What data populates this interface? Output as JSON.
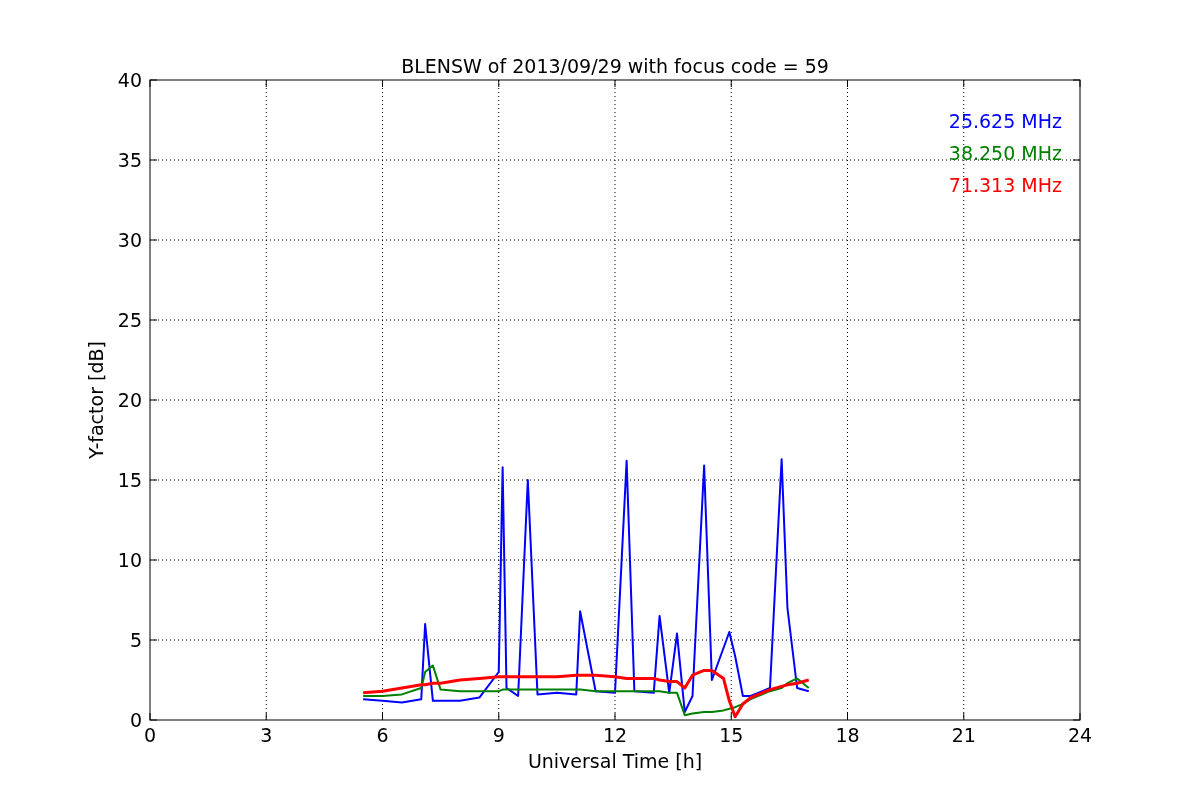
{
  "chart_data": {
    "type": "line",
    "title": "BLENSW of 2013/09/29 with focus code = 59",
    "xlabel": "Universal Time [h]",
    "ylabel": "Y-factor [dB]",
    "x": [
      5.5,
      6,
      6.5,
      7,
      7.1,
      7.3,
      7.5,
      8,
      8.5,
      9,
      9.1,
      9.2,
      9.5,
      9.75,
      10,
      10.5,
      11,
      11.1,
      11.5,
      12,
      12.3,
      12.5,
      13,
      13.15,
      13.4,
      13.6,
      13.8,
      14,
      14.3,
      14.5,
      14.8,
      14.95,
      15.1,
      15.3,
      15.5,
      16,
      16.3,
      16.45,
      16.7,
      17
    ],
    "series": [
      {
        "name": "25.625 MHz",
        "color": "#0000ff",
        "values": [
          1.3,
          1.2,
          1.1,
          1.3,
          6.0,
          1.2,
          1.2,
          1.2,
          1.4,
          3.0,
          15.8,
          2.0,
          1.5,
          15.0,
          1.6,
          1.7,
          1.6,
          6.8,
          1.8,
          1.7,
          16.2,
          1.8,
          1.7,
          6.5,
          1.7,
          5.4,
          0.5,
          1.5,
          15.9,
          2.5,
          4.5,
          5.5,
          4.0,
          1.5,
          1.5,
          2.0,
          16.3,
          7.0,
          2.0,
          1.8
        ]
      },
      {
        "name": "38.250 MHz",
        "color": "#008000",
        "values": [
          1.5,
          1.5,
          1.6,
          2.0,
          3.0,
          3.4,
          1.9,
          1.8,
          1.8,
          1.8,
          1.9,
          1.9,
          1.9,
          1.9,
          1.9,
          1.9,
          1.9,
          1.9,
          1.8,
          1.8,
          1.8,
          1.8,
          1.8,
          1.8,
          1.7,
          1.7,
          0.3,
          0.4,
          0.5,
          0.5,
          0.6,
          0.7,
          0.8,
          1.0,
          1.3,
          1.8,
          2.0,
          2.3,
          2.6,
          2.0
        ]
      },
      {
        "name": "71.313 MHz",
        "color": "#ff0000",
        "values": [
          1.7,
          1.8,
          2.0,
          2.2,
          2.2,
          2.3,
          2.3,
          2.5,
          2.6,
          2.7,
          2.7,
          2.7,
          2.7,
          2.7,
          2.7,
          2.7,
          2.8,
          2.8,
          2.8,
          2.7,
          2.6,
          2.6,
          2.6,
          2.5,
          2.4,
          2.4,
          2.0,
          2.8,
          3.1,
          3.1,
          2.6,
          1.2,
          0.2,
          1.0,
          1.4,
          1.9,
          2.1,
          2.2,
          2.3,
          2.5
        ]
      }
    ],
    "grid": true,
    "xlim": [
      0,
      24
    ],
    "ylim": [
      0,
      40
    ],
    "xticks": [
      0,
      3,
      6,
      9,
      12,
      15,
      18,
      21,
      24
    ],
    "yticks": [
      0,
      5,
      10,
      15,
      20,
      25,
      30,
      35,
      40
    ]
  }
}
